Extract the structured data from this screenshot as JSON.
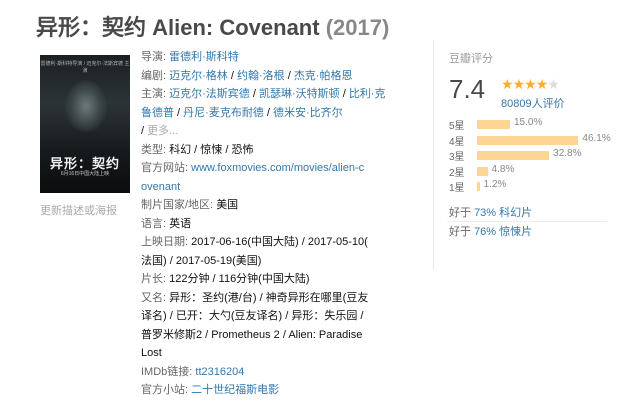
{
  "title": {
    "main": "异形：契约 Alien: Covenant",
    "year": "(2017)"
  },
  "poster": {
    "title": "异形：契约",
    "tagline": "雷德利·斯科特导演 / 迈克尔·法斯宾德 主演",
    "date": "6月16日中国大陆上映"
  },
  "update_link": "更新描述或海报",
  "info": {
    "director_label": "导演:",
    "director": "雷德利·斯科特",
    "writer_label": "编剧:",
    "writers": [
      "迈克尔·格林",
      "约翰·洛根",
      "杰克·帕格恩"
    ],
    "cast_label": "主演:",
    "cast": [
      "迈克尔·法斯宾德",
      "凯瑟琳·沃特斯顿",
      "比利·克鲁德普",
      "丹尼·麦克布耐德",
      "德米安·比齐尔"
    ],
    "more": "更多...",
    "genre_label": "类型:",
    "genres": [
      "科幻",
      "惊悚",
      "恐怖"
    ],
    "site_label": "官方网站:",
    "site_line1": "www.foxmovies.com/movies/alien-c",
    "site_line2": "ovenant",
    "country_label": "制片国家/地区:",
    "country": "美国",
    "language_label": "语言:",
    "language": "英语",
    "release_label": "上映日期:",
    "release_line1": "2017-06-16(中国大陆) / 2017-05-10(",
    "release_line2": "法国) / 2017-05-19(美国)",
    "runtime_label": "片长:",
    "runtime": "122分钟 / 116分钟(中国大陆)",
    "aka_label": "又名:",
    "aka_line1": "异形：圣约(港/台) / 神奇异形在哪里(豆友",
    "aka_line2": "译名) / 已开：大勺(豆友译名) / 异形：失乐园 /",
    "aka_line3": "普罗米修斯2 / Prometheus 2 / Alien: Paradise",
    "aka_line4": "Lost",
    "imdb_label": "IMDb链接:",
    "imdb": "tt2316204",
    "station_label": "官方小站:",
    "station": "二十世纪福斯电影"
  },
  "rating": {
    "header": "豆瓣评分",
    "score": "7.4",
    "star_value": 3.5,
    "votes": "80809",
    "votes_unit": "人评价",
    "distribution": [
      {
        "label": "5星",
        "pct": "15.0%",
        "value": 15.0
      },
      {
        "label": "4星",
        "pct": "46.1%",
        "value": 46.1
      },
      {
        "label": "3星",
        "pct": "32.8%",
        "value": 32.8
      },
      {
        "label": "2星",
        "pct": "4.8%",
        "value": 4.8
      },
      {
        "label": "1星",
        "pct": "1.2%",
        "value": 1.2
      }
    ],
    "better_than": [
      {
        "prefix": "好于",
        "text": "73% 科幻片"
      },
      {
        "prefix": "好于",
        "text": "76% 惊悚片"
      }
    ]
  },
  "colors": {
    "link": "#3377aa",
    "bar": "#ffd596",
    "star": "#ffac2d"
  }
}
